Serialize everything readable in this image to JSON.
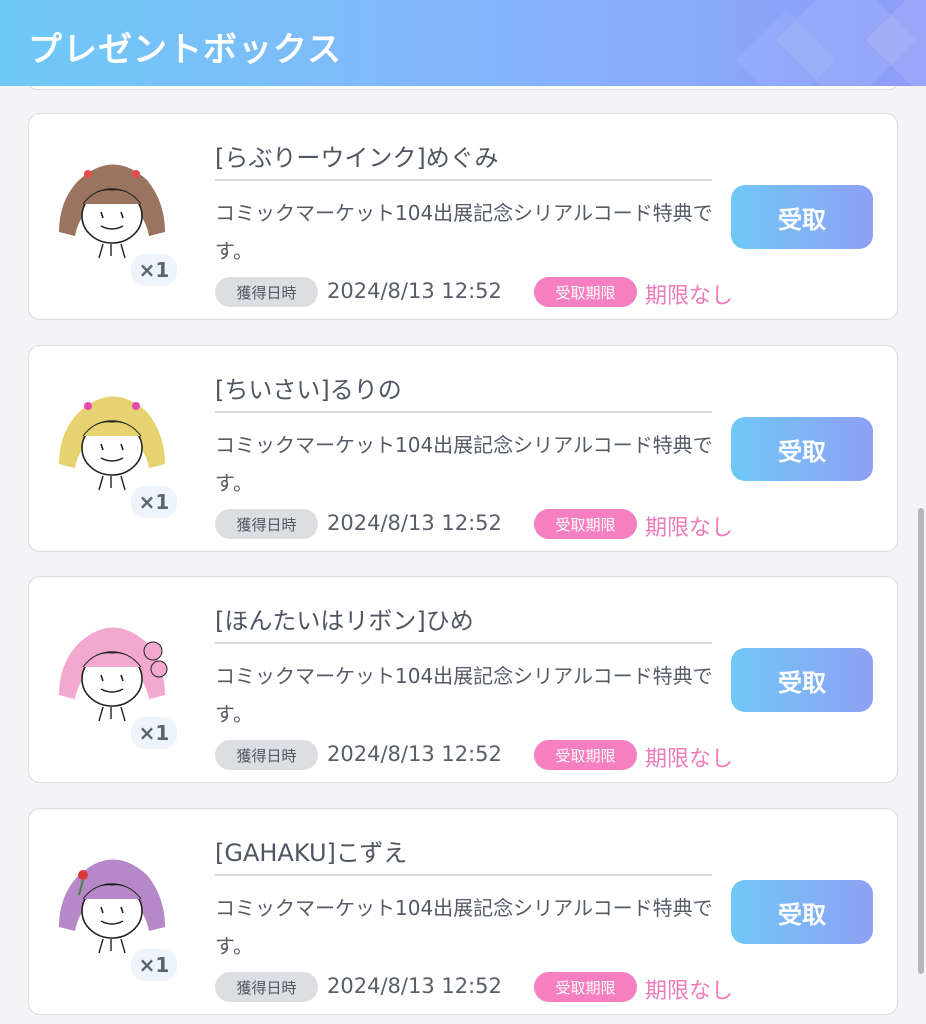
{
  "header": {
    "title": "プレゼントボックス"
  },
  "items": [
    {
      "title": "[らぶりーウインク]めぐみ",
      "description": "コミックマーケット104出展記念シリアルコード特典です。",
      "quantity": "×1",
      "acquired_label": "獲得日時",
      "acquired_date": "2024/8/13 12:52",
      "limit_label": "受取期限",
      "limit_value": "期限なし",
      "button_label": "受取",
      "hair_color": "#9a7361"
    },
    {
      "title": "[ちいさい]るりの",
      "description": "コミックマーケット104出展記念シリアルコード特典です。",
      "quantity": "×1",
      "acquired_label": "獲得日時",
      "acquired_date": "2024/8/13 12:52",
      "limit_label": "受取期限",
      "limit_value": "期限なし",
      "button_label": "受取",
      "hair_color": "#e6d271"
    },
    {
      "title": "[ほんたいはリボン]ひめ",
      "description": "コミックマーケット104出展記念シリアルコード特典です。",
      "quantity": "×1",
      "acquired_label": "獲得日時",
      "acquired_date": "2024/8/13 12:52",
      "limit_label": "受取期限",
      "limit_value": "期限なし",
      "button_label": "受取",
      "hair_color": "#f3a9cf"
    },
    {
      "title": "[GAHAKU]こずえ",
      "description": "コミックマーケット104出展記念シリアルコード特典です。",
      "quantity": "×1",
      "acquired_label": "獲得日時",
      "acquired_date": "2024/8/13 12:52",
      "limit_label": "受取期限",
      "limit_value": "期限なし",
      "button_label": "受取",
      "hair_color": "#b687c9"
    }
  ],
  "colors": {
    "accent_pink": "#f57fc0",
    "button_gradient_start": "#6fc8f6",
    "button_gradient_end": "#8fa0f5"
  }
}
